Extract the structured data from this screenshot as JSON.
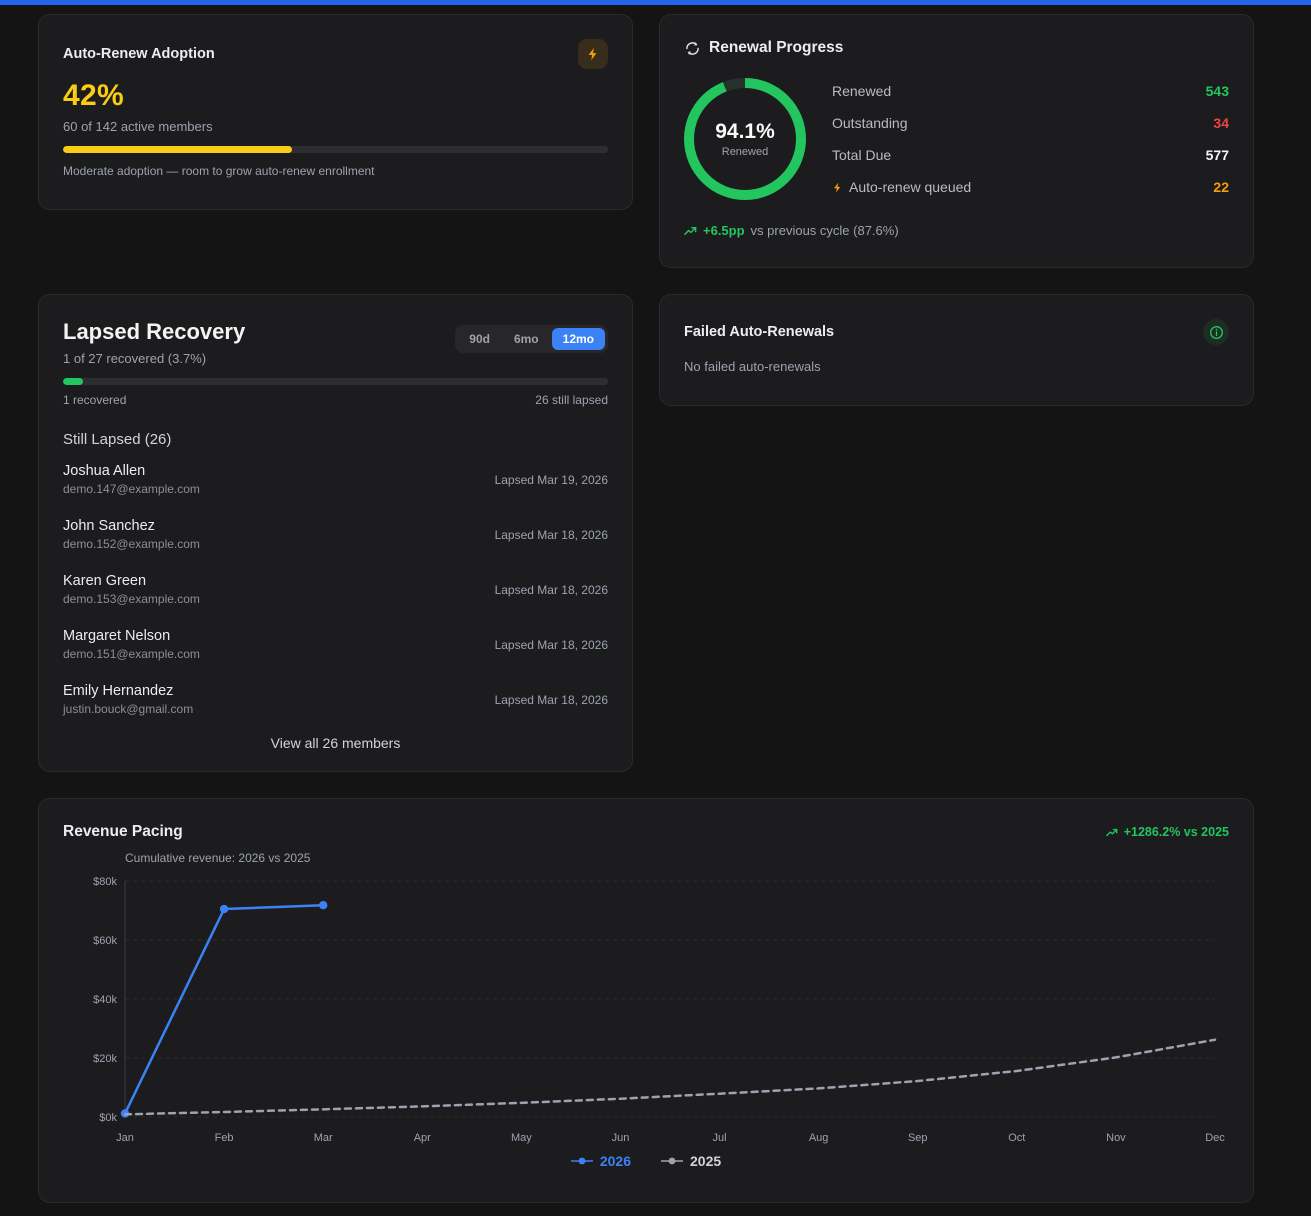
{
  "accent_bar_color": "#2563eb",
  "auto_renew_adoption": {
    "title": "Auto-Renew Adoption",
    "percent_label": "42%",
    "percent_value": 42,
    "subtitle": "60 of 142 active members",
    "caption": "Moderate adoption — room to grow auto-renew enrollment",
    "accent": "#facc15",
    "icon_color": "#f59e0b"
  },
  "renewal_progress": {
    "title": "Renewal Progress",
    "donut": {
      "percent_label": "94.1%",
      "percent_value": 94.1,
      "sub_label": "Renewed",
      "color": "#22c55e",
      "track": "#26312b"
    },
    "stats": [
      {
        "label": "Renewed",
        "value": "543",
        "color": "#22c55e"
      },
      {
        "label": "Outstanding",
        "value": "34",
        "color": "#ef4444"
      },
      {
        "label": "Total Due",
        "value": "577",
        "color": "#f5f5f5"
      },
      {
        "label": "Auto-renew queued",
        "value": "22",
        "color": "#f59e0b",
        "icon": "lightning-icon"
      }
    ],
    "footer": {
      "delta": "+6.5pp",
      "text": "vs previous cycle (87.6%)",
      "delta_color": "#22c55e"
    }
  },
  "lapsed_recovery": {
    "title": "Lapsed Recovery",
    "subtitle": "1 of 27 recovered (3.7%)",
    "ranges": [
      {
        "label": "90d",
        "active": false
      },
      {
        "label": "6mo",
        "active": false
      },
      {
        "label": "12mo",
        "active": true
      }
    ],
    "progress_percent": 3.7,
    "accent": "#22c55e",
    "recovered_label": "1 recovered",
    "lapsed_label": "26 still lapsed",
    "section_title": "Still Lapsed (26)",
    "members": [
      {
        "name": "Joshua Allen",
        "email": "demo.147@example.com",
        "lapsed": "Lapsed Mar 19, 2026"
      },
      {
        "name": "John Sanchez",
        "email": "demo.152@example.com",
        "lapsed": "Lapsed Mar 18, 2026"
      },
      {
        "name": "Karen Green",
        "email": "demo.153@example.com",
        "lapsed": "Lapsed Mar 18, 2026"
      },
      {
        "name": "Margaret Nelson",
        "email": "demo.151@example.com",
        "lapsed": "Lapsed Mar 18, 2026"
      },
      {
        "name": "Emily Hernandez",
        "email": "justin.bouck@gmail.com",
        "lapsed": "Lapsed Mar 18, 2026"
      }
    ],
    "view_all_label": "View all 26 members"
  },
  "failed_auto_renewals": {
    "title": "Failed Auto-Renewals",
    "message": "No failed auto-renewals",
    "icon_color": "#22c55e"
  },
  "revenue_pacing": {
    "title": "Revenue Pacing",
    "delta": "+1286.2% vs 2025",
    "delta_color": "#22c55e",
    "subtitle": "Cumulative revenue: 2026 vs 2025"
  },
  "chart_data": {
    "type": "line",
    "title": "Cumulative revenue: 2026 vs 2025",
    "x": [
      "Jan",
      "Feb",
      "Mar",
      "Apr",
      "May",
      "Jun",
      "Jul",
      "Aug",
      "Sep",
      "Oct",
      "Nov",
      "Dec"
    ],
    "y_ticks": [
      "$0k",
      "$20k",
      "$40k",
      "$60k",
      "$80k"
    ],
    "ylim": [
      0,
      80000
    ],
    "grid": "horizontal-dashed",
    "legend_position": "bottom-center",
    "series": [
      {
        "name": "2026",
        "color": "#3b82f6",
        "dashed": false,
        "markers": true,
        "values": [
          1200,
          70500,
          71800
        ]
      },
      {
        "name": "2025",
        "color": "#9ca3af",
        "dashed": true,
        "markers": false,
        "values": [
          900,
          1700,
          2600,
          3600,
          4800,
          6200,
          7900,
          9700,
          12200,
          15600,
          20200,
          26200
        ]
      }
    ]
  }
}
